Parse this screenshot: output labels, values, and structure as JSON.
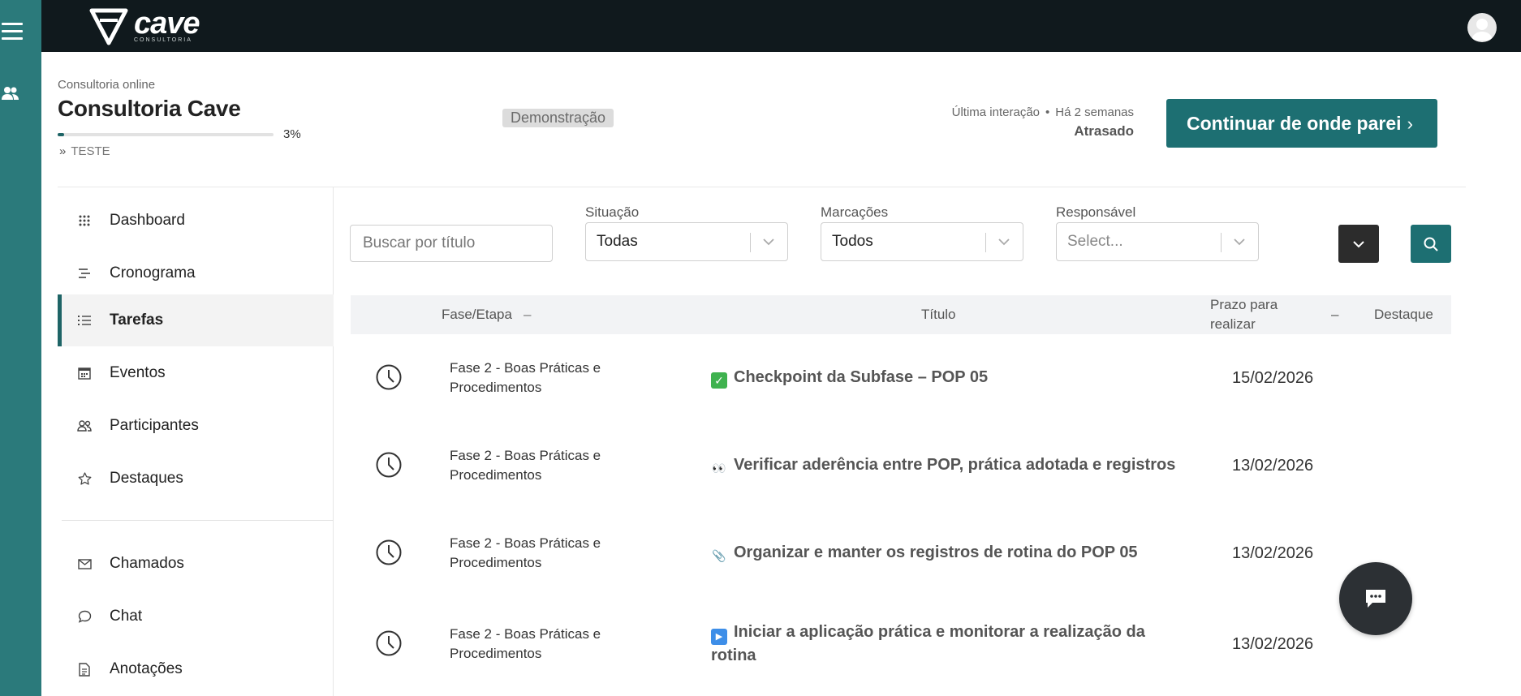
{
  "brand": {
    "name": "cave",
    "subtitle": "CONSULTORIA"
  },
  "header": {
    "eyebrow": "Consultoria online",
    "title": "Consultoria Cave",
    "progress_percent": 3,
    "progress_label": "3%",
    "sub_crumb_chevron": "»",
    "sub_crumb": "TESTE",
    "badge": "Demonstração",
    "last_interaction_label": "Última interação",
    "last_interaction_sep": "•",
    "last_interaction_value": "Há 2 semanas",
    "status": "Atrasado",
    "cta_label": "Continuar de onde parei",
    "cta_arrow": "›"
  },
  "sidebar": {
    "items": [
      {
        "label": "Dashboard",
        "icon": "grid-icon"
      },
      {
        "label": "Cronograma",
        "icon": "timeline-icon"
      },
      {
        "label": "Tarefas",
        "icon": "list-icon",
        "active": true
      },
      {
        "label": "Eventos",
        "icon": "calendar-icon"
      },
      {
        "label": "Participantes",
        "icon": "users-icon"
      },
      {
        "label": "Destaques",
        "icon": "star-icon"
      }
    ],
    "secondary": [
      {
        "label": "Chamados",
        "icon": "mail-icon"
      },
      {
        "label": "Chat",
        "icon": "chat-bubble-icon"
      },
      {
        "label": "Anotações",
        "icon": "document-icon"
      }
    ]
  },
  "filters": {
    "search_placeholder": "Buscar por título",
    "situacao": {
      "label": "Situação",
      "value": "Todas"
    },
    "marcacoes": {
      "label": "Marcações",
      "value": "Todos"
    },
    "responsavel": {
      "label": "Responsável",
      "placeholder": "Select..."
    }
  },
  "table": {
    "headers": {
      "fase": "Fase/Etapa",
      "fase_sort": "–",
      "titulo": "Título",
      "prazo": "Prazo para realizar",
      "prazo_sort": "–",
      "destaque": "Destaque"
    },
    "rows": [
      {
        "phase": "Fase 2 - Boas Práticas e Procedimentos",
        "emoji": "✓",
        "emoji_color": "#3fb24f",
        "title": "Checkpoint da Subfase – POP 05",
        "date": "15/02/2026"
      },
      {
        "phase": "Fase 2 - Boas Práticas e Procedimentos",
        "emoji": "👀",
        "emoji_color": "#ffffff",
        "title": "Verificar aderência entre POP, prática adotada e registros",
        "date": "13/02/2026"
      },
      {
        "phase": "Fase 2 - Boas Práticas e Procedimentos",
        "emoji": "📎",
        "emoji_color": "#ffffff",
        "title": "Organizar e manter os registros de rotina do POP 05",
        "date": "13/02/2026"
      },
      {
        "phase": "Fase 2 - Boas Práticas e Procedimentos",
        "emoji": "▶",
        "emoji_color": "#3d8ee8",
        "title": "Iniciar a aplicação prática e monitorar a realização da rotina",
        "date": "13/02/2026"
      }
    ]
  },
  "colors": {
    "teal": "#1d6f72",
    "rail": "#2b7a7b",
    "topbar": "#10191d"
  }
}
